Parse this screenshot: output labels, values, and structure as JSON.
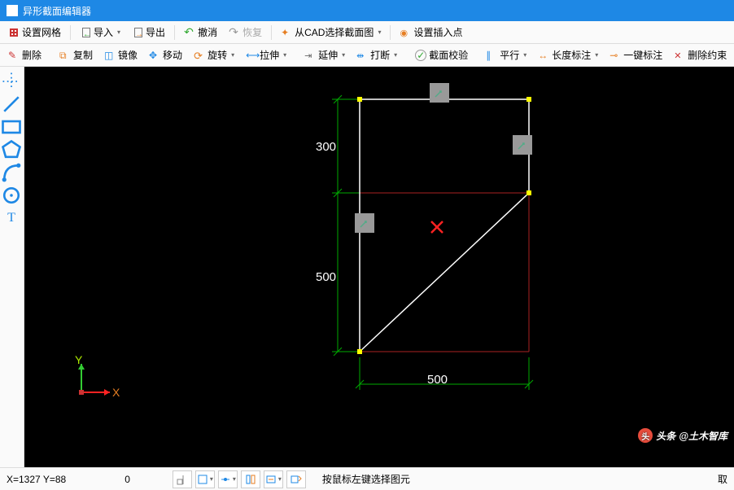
{
  "title": "异形截面编辑器",
  "toolbar1": {
    "grid": "设置网格",
    "import": "导入",
    "export": "导出",
    "undo": "撤消",
    "redo": "恢复",
    "cad": "从CAD选择截面图",
    "insert": "设置插入点"
  },
  "toolbar2": {
    "delete": "删除",
    "copy": "复制",
    "mirror": "镜像",
    "move": "移动",
    "rotate": "旋转",
    "stretch": "拉伸",
    "extend": "延伸",
    "break": "打断",
    "verify": "截面校验",
    "parallel": "平行",
    "length": "长度标注",
    "onekey": "一键标注",
    "delconstraint": "删除约束"
  },
  "dims": {
    "d300": "300",
    "d500v": "500",
    "d500h": "500"
  },
  "axis": {
    "x": "X",
    "y": "Y"
  },
  "status": {
    "coords": "X=1327 Y=88",
    "zero": "0",
    "hint": "按鼠标左键选择图元",
    "cancel": "取"
  },
  "watermark": {
    "prefix": "头条",
    "text": "@土木智库"
  }
}
